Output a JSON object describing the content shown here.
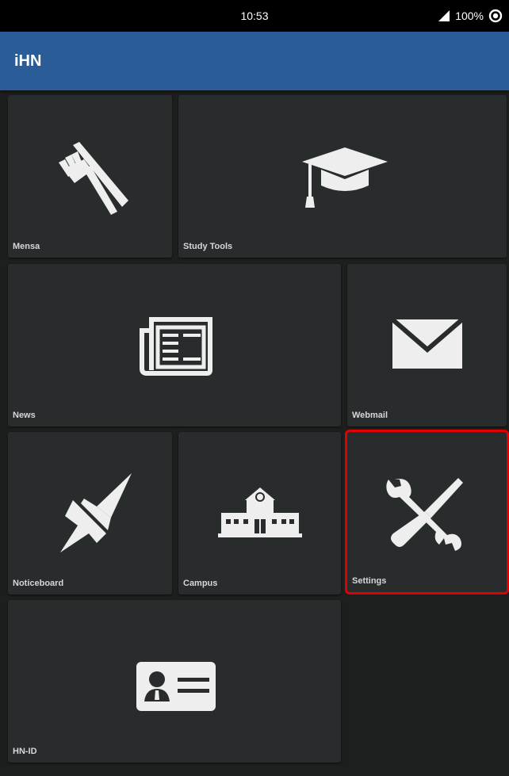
{
  "status_bar": {
    "time": "10:53",
    "battery": "100%",
    "icons": [
      "signal-icon",
      "sync-icon"
    ]
  },
  "app_bar": {
    "title": "iHN"
  },
  "tiles": {
    "mensa": {
      "label": "Mensa",
      "icon": "fork-knife-icon"
    },
    "study_tools": {
      "label": "Study Tools",
      "icon": "graduation-cap-icon"
    },
    "news": {
      "label": "News",
      "icon": "newspaper-icon"
    },
    "webmail": {
      "label": "Webmail",
      "icon": "envelope-icon"
    },
    "noticeboard": {
      "label": "Noticeboard",
      "icon": "pushpin-icon"
    },
    "campus": {
      "label": "Campus",
      "icon": "building-icon"
    },
    "settings": {
      "label": "Settings",
      "icon": "wrench-screwdriver-icon",
      "highlight_color": "#e30000"
    },
    "hn_id": {
      "label": "HN-ID",
      "icon": "id-card-icon"
    }
  },
  "colors": {
    "app_bar": "#2a5d97",
    "tile_background": "#292c2d",
    "icon": "#eeeeee",
    "highlight": "#e30000"
  }
}
